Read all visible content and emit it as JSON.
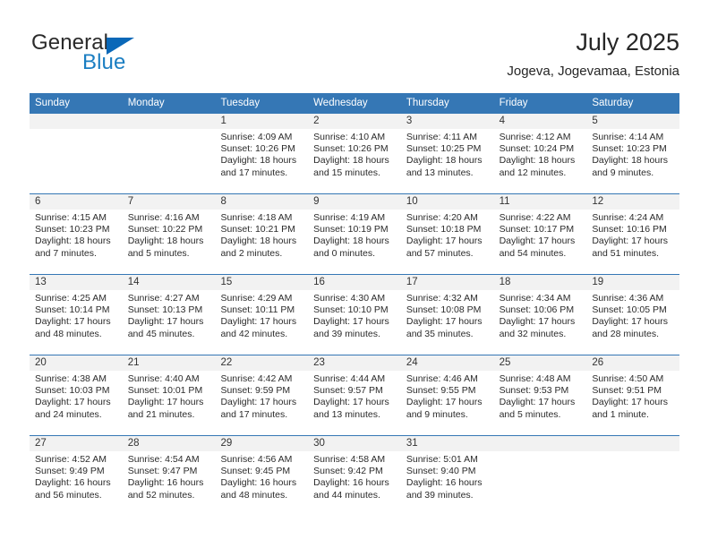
{
  "brand": {
    "name_top": "General",
    "name_bottom": "Blue",
    "triangle_color": "#0a68b8",
    "blue_color": "#1b7ec2"
  },
  "header": {
    "title": "July 2025",
    "location": "Jogeva, Jogevamaa, Estonia"
  },
  "theme": {
    "header_blue": "#3577b5",
    "day_band_gray": "#f2f2f2",
    "text": "#2b2b2b"
  },
  "weekdays": [
    "Sunday",
    "Monday",
    "Tuesday",
    "Wednesday",
    "Thursday",
    "Friday",
    "Saturday"
  ],
  "weeks": [
    [
      {
        "day": "",
        "sunrise": "",
        "sunset": "",
        "daylight_line1": "",
        "daylight_line2": ""
      },
      {
        "day": "",
        "sunrise": "",
        "sunset": "",
        "daylight_line1": "",
        "daylight_line2": ""
      },
      {
        "day": "1",
        "sunrise": "Sunrise: 4:09 AM",
        "sunset": "Sunset: 10:26 PM",
        "daylight_line1": "Daylight: 18 hours",
        "daylight_line2": "and 17 minutes."
      },
      {
        "day": "2",
        "sunrise": "Sunrise: 4:10 AM",
        "sunset": "Sunset: 10:26 PM",
        "daylight_line1": "Daylight: 18 hours",
        "daylight_line2": "and 15 minutes."
      },
      {
        "day": "3",
        "sunrise": "Sunrise: 4:11 AM",
        "sunset": "Sunset: 10:25 PM",
        "daylight_line1": "Daylight: 18 hours",
        "daylight_line2": "and 13 minutes."
      },
      {
        "day": "4",
        "sunrise": "Sunrise: 4:12 AM",
        "sunset": "Sunset: 10:24 PM",
        "daylight_line1": "Daylight: 18 hours",
        "daylight_line2": "and 12 minutes."
      },
      {
        "day": "5",
        "sunrise": "Sunrise: 4:14 AM",
        "sunset": "Sunset: 10:23 PM",
        "daylight_line1": "Daylight: 18 hours",
        "daylight_line2": "and 9 minutes."
      }
    ],
    [
      {
        "day": "6",
        "sunrise": "Sunrise: 4:15 AM",
        "sunset": "Sunset: 10:23 PM",
        "daylight_line1": "Daylight: 18 hours",
        "daylight_line2": "and 7 minutes."
      },
      {
        "day": "7",
        "sunrise": "Sunrise: 4:16 AM",
        "sunset": "Sunset: 10:22 PM",
        "daylight_line1": "Daylight: 18 hours",
        "daylight_line2": "and 5 minutes."
      },
      {
        "day": "8",
        "sunrise": "Sunrise: 4:18 AM",
        "sunset": "Sunset: 10:21 PM",
        "daylight_line1": "Daylight: 18 hours",
        "daylight_line2": "and 2 minutes."
      },
      {
        "day": "9",
        "sunrise": "Sunrise: 4:19 AM",
        "sunset": "Sunset: 10:19 PM",
        "daylight_line1": "Daylight: 18 hours",
        "daylight_line2": "and 0 minutes."
      },
      {
        "day": "10",
        "sunrise": "Sunrise: 4:20 AM",
        "sunset": "Sunset: 10:18 PM",
        "daylight_line1": "Daylight: 17 hours",
        "daylight_line2": "and 57 minutes."
      },
      {
        "day": "11",
        "sunrise": "Sunrise: 4:22 AM",
        "sunset": "Sunset: 10:17 PM",
        "daylight_line1": "Daylight: 17 hours",
        "daylight_line2": "and 54 minutes."
      },
      {
        "day": "12",
        "sunrise": "Sunrise: 4:24 AM",
        "sunset": "Sunset: 10:16 PM",
        "daylight_line1": "Daylight: 17 hours",
        "daylight_line2": "and 51 minutes."
      }
    ],
    [
      {
        "day": "13",
        "sunrise": "Sunrise: 4:25 AM",
        "sunset": "Sunset: 10:14 PM",
        "daylight_line1": "Daylight: 17 hours",
        "daylight_line2": "and 48 minutes."
      },
      {
        "day": "14",
        "sunrise": "Sunrise: 4:27 AM",
        "sunset": "Sunset: 10:13 PM",
        "daylight_line1": "Daylight: 17 hours",
        "daylight_line2": "and 45 minutes."
      },
      {
        "day": "15",
        "sunrise": "Sunrise: 4:29 AM",
        "sunset": "Sunset: 10:11 PM",
        "daylight_line1": "Daylight: 17 hours",
        "daylight_line2": "and 42 minutes."
      },
      {
        "day": "16",
        "sunrise": "Sunrise: 4:30 AM",
        "sunset": "Sunset: 10:10 PM",
        "daylight_line1": "Daylight: 17 hours",
        "daylight_line2": "and 39 minutes."
      },
      {
        "day": "17",
        "sunrise": "Sunrise: 4:32 AM",
        "sunset": "Sunset: 10:08 PM",
        "daylight_line1": "Daylight: 17 hours",
        "daylight_line2": "and 35 minutes."
      },
      {
        "day": "18",
        "sunrise": "Sunrise: 4:34 AM",
        "sunset": "Sunset: 10:06 PM",
        "daylight_line1": "Daylight: 17 hours",
        "daylight_line2": "and 32 minutes."
      },
      {
        "day": "19",
        "sunrise": "Sunrise: 4:36 AM",
        "sunset": "Sunset: 10:05 PM",
        "daylight_line1": "Daylight: 17 hours",
        "daylight_line2": "and 28 minutes."
      }
    ],
    [
      {
        "day": "20",
        "sunrise": "Sunrise: 4:38 AM",
        "sunset": "Sunset: 10:03 PM",
        "daylight_line1": "Daylight: 17 hours",
        "daylight_line2": "and 24 minutes."
      },
      {
        "day": "21",
        "sunrise": "Sunrise: 4:40 AM",
        "sunset": "Sunset: 10:01 PM",
        "daylight_line1": "Daylight: 17 hours",
        "daylight_line2": "and 21 minutes."
      },
      {
        "day": "22",
        "sunrise": "Sunrise: 4:42 AM",
        "sunset": "Sunset: 9:59 PM",
        "daylight_line1": "Daylight: 17 hours",
        "daylight_line2": "and 17 minutes."
      },
      {
        "day": "23",
        "sunrise": "Sunrise: 4:44 AM",
        "sunset": "Sunset: 9:57 PM",
        "daylight_line1": "Daylight: 17 hours",
        "daylight_line2": "and 13 minutes."
      },
      {
        "day": "24",
        "sunrise": "Sunrise: 4:46 AM",
        "sunset": "Sunset: 9:55 PM",
        "daylight_line1": "Daylight: 17 hours",
        "daylight_line2": "and 9 minutes."
      },
      {
        "day": "25",
        "sunrise": "Sunrise: 4:48 AM",
        "sunset": "Sunset: 9:53 PM",
        "daylight_line1": "Daylight: 17 hours",
        "daylight_line2": "and 5 minutes."
      },
      {
        "day": "26",
        "sunrise": "Sunrise: 4:50 AM",
        "sunset": "Sunset: 9:51 PM",
        "daylight_line1": "Daylight: 17 hours",
        "daylight_line2": "and 1 minute."
      }
    ],
    [
      {
        "day": "27",
        "sunrise": "Sunrise: 4:52 AM",
        "sunset": "Sunset: 9:49 PM",
        "daylight_line1": "Daylight: 16 hours",
        "daylight_line2": "and 56 minutes."
      },
      {
        "day": "28",
        "sunrise": "Sunrise: 4:54 AM",
        "sunset": "Sunset: 9:47 PM",
        "daylight_line1": "Daylight: 16 hours",
        "daylight_line2": "and 52 minutes."
      },
      {
        "day": "29",
        "sunrise": "Sunrise: 4:56 AM",
        "sunset": "Sunset: 9:45 PM",
        "daylight_line1": "Daylight: 16 hours",
        "daylight_line2": "and 48 minutes."
      },
      {
        "day": "30",
        "sunrise": "Sunrise: 4:58 AM",
        "sunset": "Sunset: 9:42 PM",
        "daylight_line1": "Daylight: 16 hours",
        "daylight_line2": "and 44 minutes."
      },
      {
        "day": "31",
        "sunrise": "Sunrise: 5:01 AM",
        "sunset": "Sunset: 9:40 PM",
        "daylight_line1": "Daylight: 16 hours",
        "daylight_line2": "and 39 minutes."
      },
      {
        "day": "",
        "sunrise": "",
        "sunset": "",
        "daylight_line1": "",
        "daylight_line2": ""
      },
      {
        "day": "",
        "sunrise": "",
        "sunset": "",
        "daylight_line1": "",
        "daylight_line2": ""
      }
    ]
  ]
}
